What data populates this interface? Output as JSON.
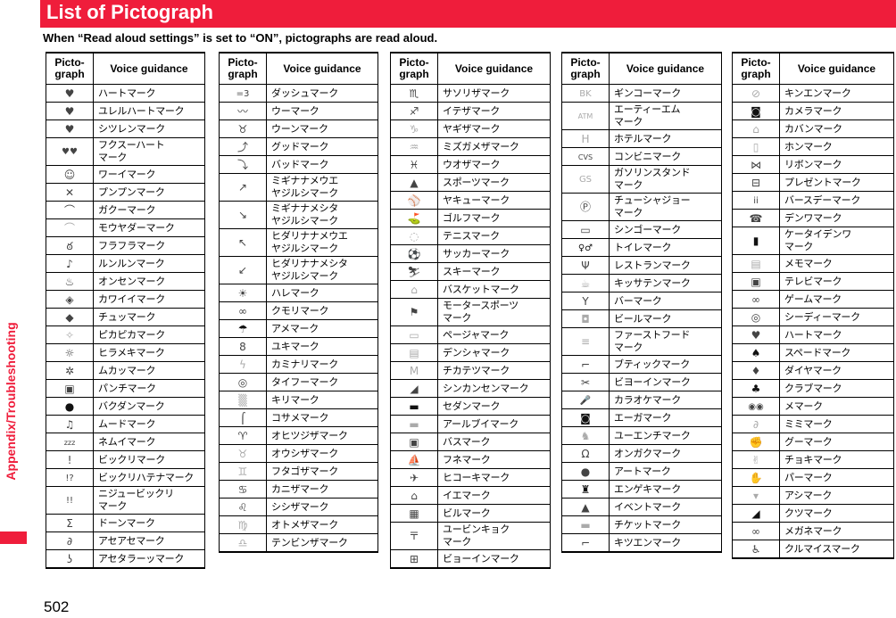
{
  "header": {
    "title": "List of Pictograph",
    "subtitle": "When “Read aloud settings” is set to “ON”, pictographs are read aloud.",
    "section": "Appendix/Troubleshooting",
    "page_number": "502",
    "accent_color": "#ef1d3b"
  },
  "columns": {
    "pictograph": "Picto-\ngraph",
    "voice": "Voice guidance"
  },
  "tables": [
    {
      "rows": [
        {
          "icon": "heart-icon",
          "glyph": "♥",
          "voice": "ハートマーク"
        },
        {
          "icon": "throbbing-heart-icon",
          "glyph": "♥",
          "voice": "ユレルハートマーク"
        },
        {
          "icon": "broken-heart-icon",
          "glyph": "♥",
          "voice": "シツレンマーク"
        },
        {
          "icon": "two-hearts-icon",
          "glyph": "♥♥",
          "voice": "フクスーハート\nマーク"
        },
        {
          "icon": "happy-face-icon",
          "glyph": "☺",
          "voice": "ワーイマーク"
        },
        {
          "icon": "angry-face-icon",
          "glyph": "✕",
          "voice": "プンプンマーク"
        },
        {
          "icon": "disappointed-face-icon",
          "glyph": "⌒",
          "voice": "ガクーマーク"
        },
        {
          "icon": "sad-face-icon",
          "glyph": "⌒",
          "voice": "モウヤダーマーク"
        },
        {
          "icon": "dizzy-face-icon",
          "glyph": "ఠ",
          "voice": "フラフラマーク"
        },
        {
          "icon": "music-note-icon",
          "glyph": "♪",
          "voice": "ルンルンマーク"
        },
        {
          "icon": "hot-spring-icon",
          "glyph": "♨",
          "voice": "オンセンマーク"
        },
        {
          "icon": "cute-icon",
          "glyph": "◈",
          "voice": "カワイイマーク"
        },
        {
          "icon": "kiss-icon",
          "glyph": "◆",
          "voice": "チュッマーク"
        },
        {
          "icon": "sparkle-icon",
          "glyph": "✧",
          "voice": "ピカピカマーク"
        },
        {
          "icon": "light-bulb-icon",
          "glyph": "☼",
          "voice": "ヒラメキマーク"
        },
        {
          "icon": "anger-icon",
          "glyph": "✲",
          "voice": "ムカッマーク"
        },
        {
          "icon": "punch-icon",
          "glyph": "▣",
          "voice": "パンチマーク"
        },
        {
          "icon": "bomb-icon",
          "glyph": "●",
          "voice": "バクダンマーク"
        },
        {
          "icon": "mood-icon",
          "glyph": "♫",
          "voice": "ムードマーク"
        },
        {
          "icon": "sleepy-icon",
          "glyph": "zzz",
          "voice": "ネムイマーク"
        },
        {
          "icon": "exclamation-icon",
          "glyph": "!",
          "voice": "ビックリマーク"
        },
        {
          "icon": "exclamation-question-icon",
          "glyph": "!?",
          "voice": "ビックリハテナマーク"
        },
        {
          "icon": "double-exclamation-icon",
          "glyph": "!!",
          "voice": "ニジュービックリ\nマーク"
        },
        {
          "icon": "bang-icon",
          "glyph": "Σ",
          "voice": "ドーンマーク"
        },
        {
          "icon": "sweat-icon",
          "glyph": "∂",
          "voice": "アセアセマーク"
        },
        {
          "icon": "drop-sweat-icon",
          "glyph": "ʖ",
          "voice": "アセタラーッマーク"
        }
      ]
    },
    {
      "rows": [
        {
          "icon": "dash-icon",
          "glyph": "=3",
          "voice": "ダッシュマーク"
        },
        {
          "icon": "wavy-dash-icon",
          "glyph": "〰",
          "voice": "ウーマーク"
        },
        {
          "icon": "hmm-icon",
          "glyph": "♉",
          "voice": "ウーンマーク"
        },
        {
          "icon": "good-arrow-icon",
          "glyph": "⤴",
          "voice": "グッドマーク"
        },
        {
          "icon": "bad-arrow-icon",
          "glyph": "⤵",
          "voice": "バッドマーク"
        },
        {
          "icon": "arrow-up-right-icon",
          "glyph": "↗",
          "voice": "ミギナナメウエ\nヤジルシマーク"
        },
        {
          "icon": "arrow-down-right-icon",
          "glyph": "↘",
          "voice": "ミギナナメシタ\nヤジルシマーク"
        },
        {
          "icon": "arrow-up-left-icon",
          "glyph": "↖",
          "voice": "ヒダリナナメウエ\nヤジルシマーク"
        },
        {
          "icon": "arrow-down-left-icon",
          "glyph": "↙",
          "voice": "ヒダリナナメシタ\nヤジルシマーク"
        },
        {
          "icon": "sun-icon",
          "glyph": "☀",
          "voice": "ハレマーク"
        },
        {
          "icon": "cloud-icon",
          "glyph": "∞",
          "voice": "クモリマーク"
        },
        {
          "icon": "umbrella-icon",
          "glyph": "☂",
          "voice": "アメマーク"
        },
        {
          "icon": "snowman-icon",
          "glyph": "8",
          "voice": "ユキマーク"
        },
        {
          "icon": "lightning-icon",
          "glyph": "ϟ",
          "voice": "カミナリマーク"
        },
        {
          "icon": "typhoon-icon",
          "glyph": "◎",
          "voice": "タイフーマーク"
        },
        {
          "icon": "fog-icon",
          "glyph": "▒",
          "voice": "キリマーク"
        },
        {
          "icon": "drizzle-icon",
          "glyph": "⌠",
          "voice": "コサメマーク"
        },
        {
          "icon": "aries-icon",
          "glyph": "♈",
          "voice": "オヒツジザマーク"
        },
        {
          "icon": "taurus-icon",
          "glyph": "♉",
          "voice": "オウシザマーク"
        },
        {
          "icon": "gemini-icon",
          "glyph": "♊",
          "voice": "フタゴザマーク"
        },
        {
          "icon": "cancer-icon",
          "glyph": "♋",
          "voice": "カニザマーク"
        },
        {
          "icon": "leo-icon",
          "glyph": "♌",
          "voice": "シシザマーク"
        },
        {
          "icon": "virgo-icon",
          "glyph": "♍",
          "voice": "オトメザマーク"
        },
        {
          "icon": "libra-icon",
          "glyph": "♎",
          "voice": "テンビンザマーク"
        }
      ]
    },
    {
      "rows": [
        {
          "icon": "scorpio-icon",
          "glyph": "♏",
          "voice": "サソリザマーク"
        },
        {
          "icon": "sagittarius-icon",
          "glyph": "♐",
          "voice": "イテザマーク"
        },
        {
          "icon": "capricorn-icon",
          "glyph": "♑",
          "voice": "ヤギザマーク"
        },
        {
          "icon": "aquarius-icon",
          "glyph": "♒",
          "voice": "ミズガメザマーク"
        },
        {
          "icon": "pisces-icon",
          "glyph": "♓",
          "voice": "ウオザマーク"
        },
        {
          "icon": "sports-icon",
          "glyph": "▲",
          "voice": "スポーツマーク"
        },
        {
          "icon": "baseball-icon",
          "glyph": "⚾",
          "voice": "ヤキューマーク"
        },
        {
          "icon": "golf-icon",
          "glyph": "⛳",
          "voice": "ゴルフマーク"
        },
        {
          "icon": "tennis-icon",
          "glyph": "◌",
          "voice": "テニスマーク"
        },
        {
          "icon": "soccer-icon",
          "glyph": "⚽",
          "voice": "サッカーマーク"
        },
        {
          "icon": "ski-icon",
          "glyph": "⛷",
          "voice": "スキーマーク"
        },
        {
          "icon": "basketball-icon",
          "glyph": "⌂",
          "voice": "バスケットマーク"
        },
        {
          "icon": "motorsports-icon",
          "glyph": "⚑",
          "voice": "モータースポーツ\nマーク"
        },
        {
          "icon": "pager-icon",
          "glyph": "▭",
          "voice": "ページャマーク"
        },
        {
          "icon": "train-icon",
          "glyph": "▤",
          "voice": "デンシャマーク"
        },
        {
          "icon": "subway-icon",
          "glyph": "M",
          "voice": "チカテツマーク"
        },
        {
          "icon": "bullet-train-icon",
          "glyph": "◢",
          "voice": "シンカンセンマーク"
        },
        {
          "icon": "car-icon",
          "glyph": "▬",
          "voice": "セダンマーク"
        },
        {
          "icon": "rv-icon",
          "glyph": "▬",
          "voice": "アールブイマーク"
        },
        {
          "icon": "bus-icon",
          "glyph": "▣",
          "voice": "バスマーク"
        },
        {
          "icon": "ship-icon",
          "glyph": "⛵",
          "voice": "フネマーク"
        },
        {
          "icon": "airplane-icon",
          "glyph": "✈",
          "voice": "ヒコーキマーク"
        },
        {
          "icon": "house-icon",
          "glyph": "⌂",
          "voice": "イエマーク"
        },
        {
          "icon": "building-icon",
          "glyph": "▦",
          "voice": "ビルマーク"
        },
        {
          "icon": "post-office-icon",
          "glyph": "〒",
          "voice": "ユービンキョク\nマーク"
        },
        {
          "icon": "hospital-icon",
          "glyph": "⊞",
          "voice": "ビョーインマーク"
        }
      ]
    },
    {
      "rows": [
        {
          "icon": "bank-icon",
          "glyph": "BK",
          "voice": "ギンコーマーク"
        },
        {
          "icon": "atm-icon",
          "glyph": "ATM",
          "voice": "エーティーエム\nマーク"
        },
        {
          "icon": "hotel-icon",
          "glyph": "H",
          "voice": "ホテルマーク"
        },
        {
          "icon": "convenience-store-icon",
          "glyph": "CVS",
          "voice": "コンビニマーク"
        },
        {
          "icon": "gas-station-icon",
          "glyph": "GS",
          "voice": "ガソリンスタンド\nマーク"
        },
        {
          "icon": "parking-icon",
          "glyph": "Ⓟ",
          "voice": "チューシャジョー\nマーク"
        },
        {
          "icon": "traffic-light-icon",
          "glyph": "▭",
          "voice": "シンゴーマーク"
        },
        {
          "icon": "restroom-icon",
          "glyph": "♀♂",
          "voice": "トイレマーク"
        },
        {
          "icon": "restaurant-icon",
          "glyph": "Ψ",
          "voice": "レストランマーク"
        },
        {
          "icon": "cafe-icon",
          "glyph": "☕",
          "voice": "キッサテンマーク"
        },
        {
          "icon": "bar-icon",
          "glyph": "Y",
          "voice": "バーマーク"
        },
        {
          "icon": "beer-icon",
          "glyph": "◘",
          "voice": "ビールマーク"
        },
        {
          "icon": "fast-food-icon",
          "glyph": "≡",
          "voice": "ファーストフード\nマーク"
        },
        {
          "icon": "boutique-icon",
          "glyph": "⌐",
          "voice": "ブティックマーク"
        },
        {
          "icon": "beauty-salon-icon",
          "glyph": "✂",
          "voice": "ビヨーインマーク"
        },
        {
          "icon": "karaoke-icon",
          "glyph": "🎤",
          "voice": "カラオケマーク"
        },
        {
          "icon": "movie-icon",
          "glyph": "◙",
          "voice": "エーガマーク"
        },
        {
          "icon": "amusement-park-icon",
          "glyph": "♞",
          "voice": "ユーエンチマーク"
        },
        {
          "icon": "music-icon",
          "glyph": "Ω",
          "voice": "オンガクマーク"
        },
        {
          "icon": "art-icon",
          "glyph": "●",
          "voice": "アートマーク"
        },
        {
          "icon": "theater-icon",
          "glyph": "♜",
          "voice": "エンゲキマーク"
        },
        {
          "icon": "event-icon",
          "glyph": "▲",
          "voice": "イベントマーク"
        },
        {
          "icon": "ticket-icon",
          "glyph": "▬",
          "voice": "チケットマーク"
        },
        {
          "icon": "smoking-icon",
          "glyph": "⌐",
          "voice": "キツエンマーク"
        }
      ]
    },
    {
      "rows": [
        {
          "icon": "no-smoking-icon",
          "glyph": "⊘",
          "voice": "キンエンマーク"
        },
        {
          "icon": "camera-icon",
          "glyph": "◙",
          "voice": "カメラマーク"
        },
        {
          "icon": "bag-icon",
          "glyph": "⌂",
          "voice": "カバンマーク"
        },
        {
          "icon": "book-icon",
          "glyph": "▯",
          "voice": "ホンマーク"
        },
        {
          "icon": "ribbon-icon",
          "glyph": "⋈",
          "voice": "リボンマーク"
        },
        {
          "icon": "present-icon",
          "glyph": "⊟",
          "voice": "プレゼントマーク"
        },
        {
          "icon": "birthday-icon",
          "glyph": "ii",
          "voice": "バースデーマーク"
        },
        {
          "icon": "telephone-icon",
          "glyph": "☎",
          "voice": "デンワマーク"
        },
        {
          "icon": "mobile-phone-icon",
          "glyph": "▮",
          "voice": "ケータイデンワ\nマーク"
        },
        {
          "icon": "memo-icon",
          "glyph": "▤",
          "voice": "メモマーク"
        },
        {
          "icon": "tv-icon",
          "glyph": "▣",
          "voice": "テレビマーク"
        },
        {
          "icon": "game-icon",
          "glyph": "∞",
          "voice": "ゲームマーク"
        },
        {
          "icon": "cd-icon",
          "glyph": "◎",
          "voice": "シーディーマーク"
        },
        {
          "icon": "heart-suit-icon",
          "glyph": "♥",
          "voice": "ハートマーク"
        },
        {
          "icon": "spade-icon",
          "glyph": "♠",
          "voice": "スペードマーク"
        },
        {
          "icon": "diamond-icon",
          "glyph": "♦",
          "voice": "ダイヤマーク"
        },
        {
          "icon": "club-icon",
          "glyph": "♣",
          "voice": "クラブマーク"
        },
        {
          "icon": "eyes-icon",
          "glyph": "◉◉",
          "voice": "メマーク"
        },
        {
          "icon": "ear-icon",
          "glyph": "∂",
          "voice": "ミミマーク"
        },
        {
          "icon": "rock-hand-icon",
          "glyph": "✊",
          "voice": "グーマーク"
        },
        {
          "icon": "scissors-hand-icon",
          "glyph": "✌",
          "voice": "チョキマーク"
        },
        {
          "icon": "paper-hand-icon",
          "glyph": "✋",
          "voice": "パーマーク"
        },
        {
          "icon": "foot-icon",
          "glyph": "▾",
          "voice": "アシマーク"
        },
        {
          "icon": "shoe-icon",
          "glyph": "◢",
          "voice": "クツマーク"
        },
        {
          "icon": "eyeglasses-icon",
          "glyph": "∞",
          "voice": "メガネマーク"
        },
        {
          "icon": "wheelchair-icon",
          "glyph": "♿",
          "voice": "クルマイスマーク"
        }
      ]
    }
  ]
}
